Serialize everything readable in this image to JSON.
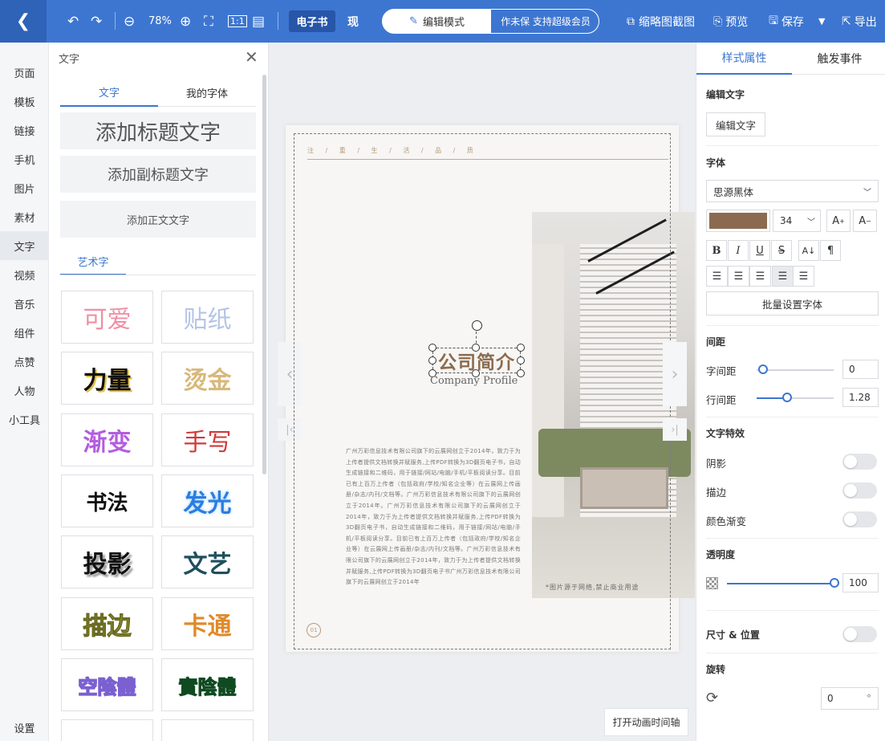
{
  "topbar": {
    "back_icon": "chevron-left-icon",
    "zoom": "78%",
    "ebook_tab": "电子书",
    "other_tab": "现",
    "mode_edit": "编辑模式",
    "mode_right_text": "作未保  支持超级会员",
    "thumb_label": "缩略图截图",
    "preview_label": "预览",
    "save_label": "保存",
    "export_label": "导出"
  },
  "leftnav": {
    "items": [
      "页面",
      "模板",
      "链接",
      "手机",
      "图片",
      "素材",
      "文字",
      "视频",
      "音乐",
      "组件",
      "点赞",
      "人物",
      "小工具"
    ],
    "settings": "设置"
  },
  "textpanel": {
    "title": "文字",
    "tab_text": "文字",
    "tab_myfont": "我的字体",
    "add_title": "添加标题文字",
    "add_subtitle": "添加副标题文字",
    "add_body": "添加正文文字",
    "art_tab": "艺术字",
    "art_items": [
      "可爱",
      "贴纸",
      "力量",
      "烫金",
      "渐变",
      "手写",
      "书法",
      "发光",
      "投影",
      "文艺",
      "描边",
      "卡通",
      "空陰體",
      "實陰體"
    ]
  },
  "canvas": {
    "header": "注 / 重 / 生 / 活 / 品 / 质",
    "title": "公司简介",
    "subtitle": "Company Profile",
    "body": "广州万彩信息技术有限公司旗下的云展网创立于2014年，致力于为上传者提供文档转换并赋服务,上传PDF转换为3D翻页电子书，自动生成链接和二维码，用于链接/网站/电脑/手机/平板阅读分享。目前已有上百万上传者（包括政府/学校/知名企业等）在云展网上传画册/杂志/内刊/文档等。广州万彩信息技术有限公司旗下的云展网创立于2014年。广州万彩信息技术有限公司旗下的云展网创立于2014年，致力于为上传者提供文档转换并赋服务,上传PDF转换为3D翻页电子书，自动生成链接和二维码，用于链接/网站/电脑/手机/平板阅读分享。目前已有上百万上传者（包括政府/学校/知名企业等）在云展网上传画册/杂志/内刊/文档等。广州万彩信息技术有限公司旗下的云展网创立于2014年，致力于为上传者提供文档转换并赋服务,上传PDF转换为3D翻页电子书广州万彩信息技术有限公司旗下的云展网创立于2014年",
    "photo_caption": "*图片源于网络,禁止商业用途",
    "page_number": "01",
    "anim_button": "打开动画时间轴"
  },
  "props": {
    "tab_style": "样式属性",
    "tab_trigger": "触发事件",
    "edit_text_section": "编辑文字",
    "edit_text_button": "编辑文字",
    "font_section": "字体",
    "font_name": "思源黑体",
    "font_color": "#8b6b50",
    "font_size": "34",
    "batch_font": "批量设置字体",
    "spacing_section": "间距",
    "letter_spacing_label": "字间距",
    "letter_spacing_value": "0",
    "line_spacing_label": "行间距",
    "line_spacing_value": "1.28",
    "effects_section": "文字特效",
    "shadow_label": "阴影",
    "stroke_label": "描边",
    "gradient_label": "颜色渐变",
    "opacity_section": "透明度",
    "opacity_value": "100",
    "size_pos_label": "尺寸 & 位置",
    "rotate_section": "旋转",
    "rotate_value": "0",
    "rotate_unit": "°"
  },
  "colors": {
    "accent": "#3d76d1",
    "brand_brown": "#8b6b4e"
  }
}
